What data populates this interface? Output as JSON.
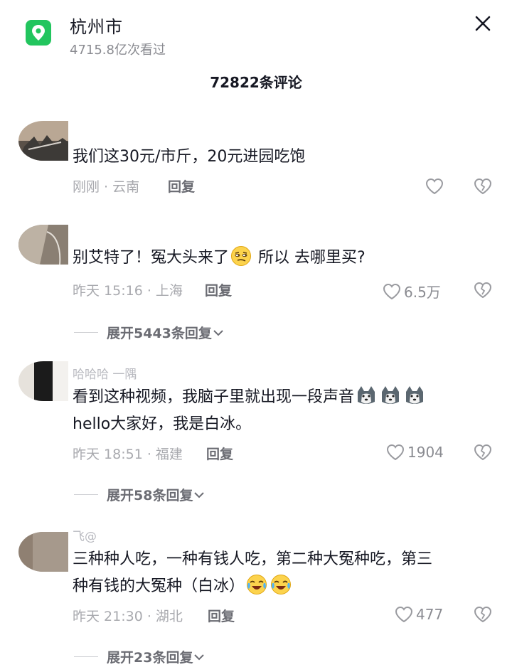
{
  "header": {
    "location": "杭州市",
    "views": "4715.8亿次看过",
    "comment_count": "72822条评论"
  },
  "icons": {
    "location": "location-pin-icon",
    "close": "close-icon",
    "like": "heart-icon",
    "dislike": "broken-heart-icon",
    "expand": "chevron-down-icon"
  },
  "colors": {
    "accent": "#22c55e"
  },
  "comments": [
    {
      "text": "我们这30元/市斤，20元进园吃饱",
      "time_location": "刚刚 · 云南",
      "reply": "回复",
      "likes": ""
    },
    {
      "text_before_emoji": "别艾特了！冤大头来了",
      "text_after_emoji": " 所以 去哪里买?",
      "time_location": "昨天 15:16 · 上海",
      "reply": "回复",
      "likes": "6.5万",
      "expand": "展开5443条回复"
    },
    {
      "author": "哈哈哈 一隅",
      "text_line1": "看到这种视频，我脑子里就出现一段声音",
      "text_line2": "hello大家好，我是白冰。",
      "time_location": "昨天 18:51 · 福建",
      "reply": "回复",
      "likes": "1904",
      "expand": "展开58条回复"
    },
    {
      "author": "飞@",
      "text_line1": "三种种人吃，一种有钱人吃，第二种大冤种吃，第三",
      "text_line2": "种有钱的大冤种（白冰）",
      "time_location": "昨天 21:30 · 湖北",
      "reply": "回复",
      "likes": "477",
      "expand": "展开23条回复"
    }
  ]
}
